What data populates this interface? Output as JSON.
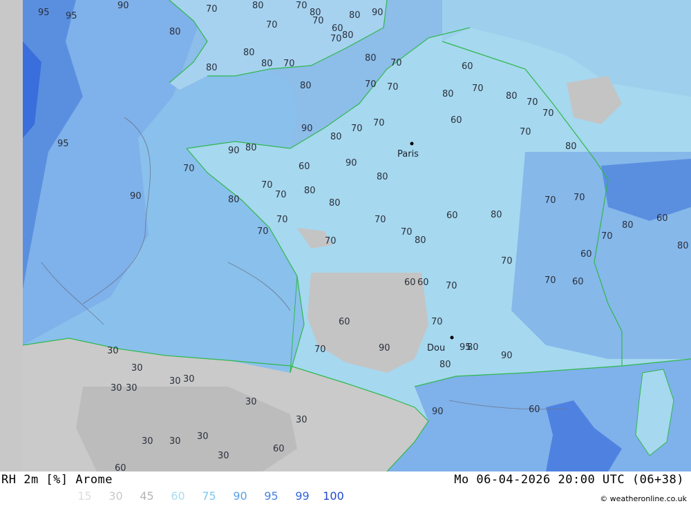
{
  "footer": {
    "title": "RH 2m [%] Arome",
    "datetime": "Mo 06-04-2026 20:00 UTC (06+38)",
    "credit": "© weatheronline.co.uk",
    "legend": [
      {
        "label": "15",
        "color": "#dcdcdc"
      },
      {
        "label": "30",
        "color": "#c8c8c8"
      },
      {
        "label": "45",
        "color": "#b4b4b4"
      },
      {
        "label": "60",
        "color": "#a8dcf0"
      },
      {
        "label": "75",
        "color": "#7ec8ec"
      },
      {
        "label": "90",
        "color": "#5aa0e6"
      },
      {
        "label": "95",
        "color": "#4682e0"
      },
      {
        "label": "99",
        "color": "#3264dc"
      },
      {
        "label": "100",
        "color": "#1e46d2"
      }
    ]
  },
  "map": {
    "cities": [
      {
        "name": "Paris"
      },
      {
        "name": "Dou"
      }
    ],
    "contour_labels": [
      "95",
      "95",
      "90",
      "70",
      "80",
      "70",
      "80",
      "70",
      "80",
      "90",
      "80",
      "70",
      "60",
      "70",
      "80",
      "95",
      "90",
      "80",
      "70",
      "80",
      "80",
      "70",
      "80",
      "80",
      "70",
      "70",
      "60",
      "80",
      "70",
      "80",
      "70",
      "70",
      "60",
      "70",
      "80",
      "90",
      "80",
      "70",
      "70",
      "70",
      "80",
      "90",
      "80",
      "70",
      "70",
      "60",
      "70",
      "90",
      "80",
      "80",
      "80",
      "70",
      "70",
      "70",
      "70",
      "80",
      "60",
      "80",
      "70",
      "70",
      "60",
      "70",
      "70",
      "60",
      "70",
      "80",
      "60",
      "80",
      "60",
      "70",
      "60",
      "70",
      "30",
      "30",
      "30",
      "30",
      "30",
      "30",
      "30",
      "30",
      "30",
      "30",
      "30",
      "30",
      "60",
      "60",
      "60",
      "70",
      "90",
      "95",
      "80",
      "80",
      "90",
      "60",
      "90"
    ]
  }
}
